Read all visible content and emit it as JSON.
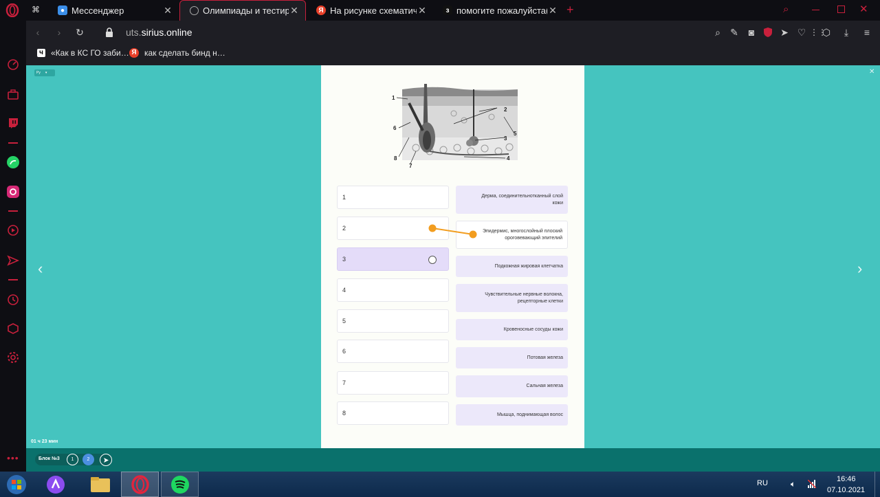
{
  "browser": {
    "tabs": [
      {
        "title": "Мессенджер",
        "icon": "messenger-icon"
      },
      {
        "title": "Олимпиады и тестирован",
        "icon": "sirius-icon",
        "active": true
      },
      {
        "title": "На рисунке схематично пр",
        "icon": "yandex-icon"
      },
      {
        "title": "помогите пожалуйста((так",
        "icon": "znanija-icon"
      }
    ],
    "new_tab": "+",
    "address": {
      "domain_prefix": "uts.",
      "domain_main": "sirius.online"
    },
    "bookmarks": [
      {
        "title": "«Как в КС ГО заби…"
      },
      {
        "title": "как сделать бинд н…"
      }
    ]
  },
  "page": {
    "lang": "Ру",
    "timer": "01 ч 23 мин",
    "diagram_labels": [
      "1",
      "2",
      "6",
      "5",
      "3",
      "8",
      "7",
      "4"
    ],
    "left_items": [
      "1",
      "2",
      "3",
      "4",
      "5",
      "6",
      "7",
      "8"
    ],
    "right_items": [
      "Дерма, соединительнотканный слой кожи",
      "Эпидермис, многослойный плоский ороговевающий эпителий",
      "Подкожная жировая клетчатка",
      "Чувствительные нервные волокна, рецепторные клетки",
      "Кровеносные сосуды кожи",
      "Потовая железа",
      "Сальная железа",
      "Мышца, поднимающая волос"
    ],
    "block_label": "Блок №3",
    "pages": [
      "1",
      "2"
    ],
    "accent_color": "#f29d1f",
    "bg_color": "#45c4bf"
  },
  "taskbar": {
    "lang": "RU",
    "time": "16:46",
    "date": "07.10.2021"
  }
}
